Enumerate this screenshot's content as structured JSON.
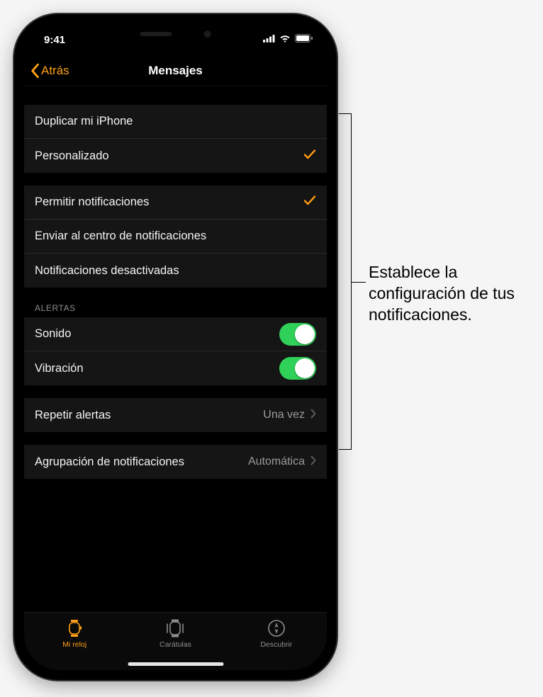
{
  "status": {
    "time": "9:41"
  },
  "nav": {
    "back": "Atrás",
    "title": "Mensajes"
  },
  "group_mode": {
    "items": [
      {
        "label": "Duplicar mi iPhone",
        "selected": false
      },
      {
        "label": "Personalizado",
        "selected": true
      }
    ]
  },
  "group_notify_mode": {
    "items": [
      {
        "label": "Permitir notificaciones",
        "selected": true
      },
      {
        "label": "Enviar al centro de notificaciones",
        "selected": false
      },
      {
        "label": "Notificaciones desactivadas",
        "selected": false
      }
    ]
  },
  "group_alerts": {
    "header": "ALERTAS",
    "items": [
      {
        "label": "Sonido",
        "on": true
      },
      {
        "label": "Vibración",
        "on": true
      }
    ]
  },
  "group_repeat": {
    "label": "Repetir alertas",
    "detail": "Una vez"
  },
  "group_grouping": {
    "label": "Agrupación de notificaciones",
    "detail": "Automática"
  },
  "tabs": [
    {
      "label": "Mi reloj",
      "icon": "watch",
      "active": true
    },
    {
      "label": "Carátulas",
      "icon": "gallery",
      "active": false
    },
    {
      "label": "Descubrir",
      "icon": "compass",
      "active": false
    }
  ],
  "callout": "Establece la configuración de tus notificaciones."
}
